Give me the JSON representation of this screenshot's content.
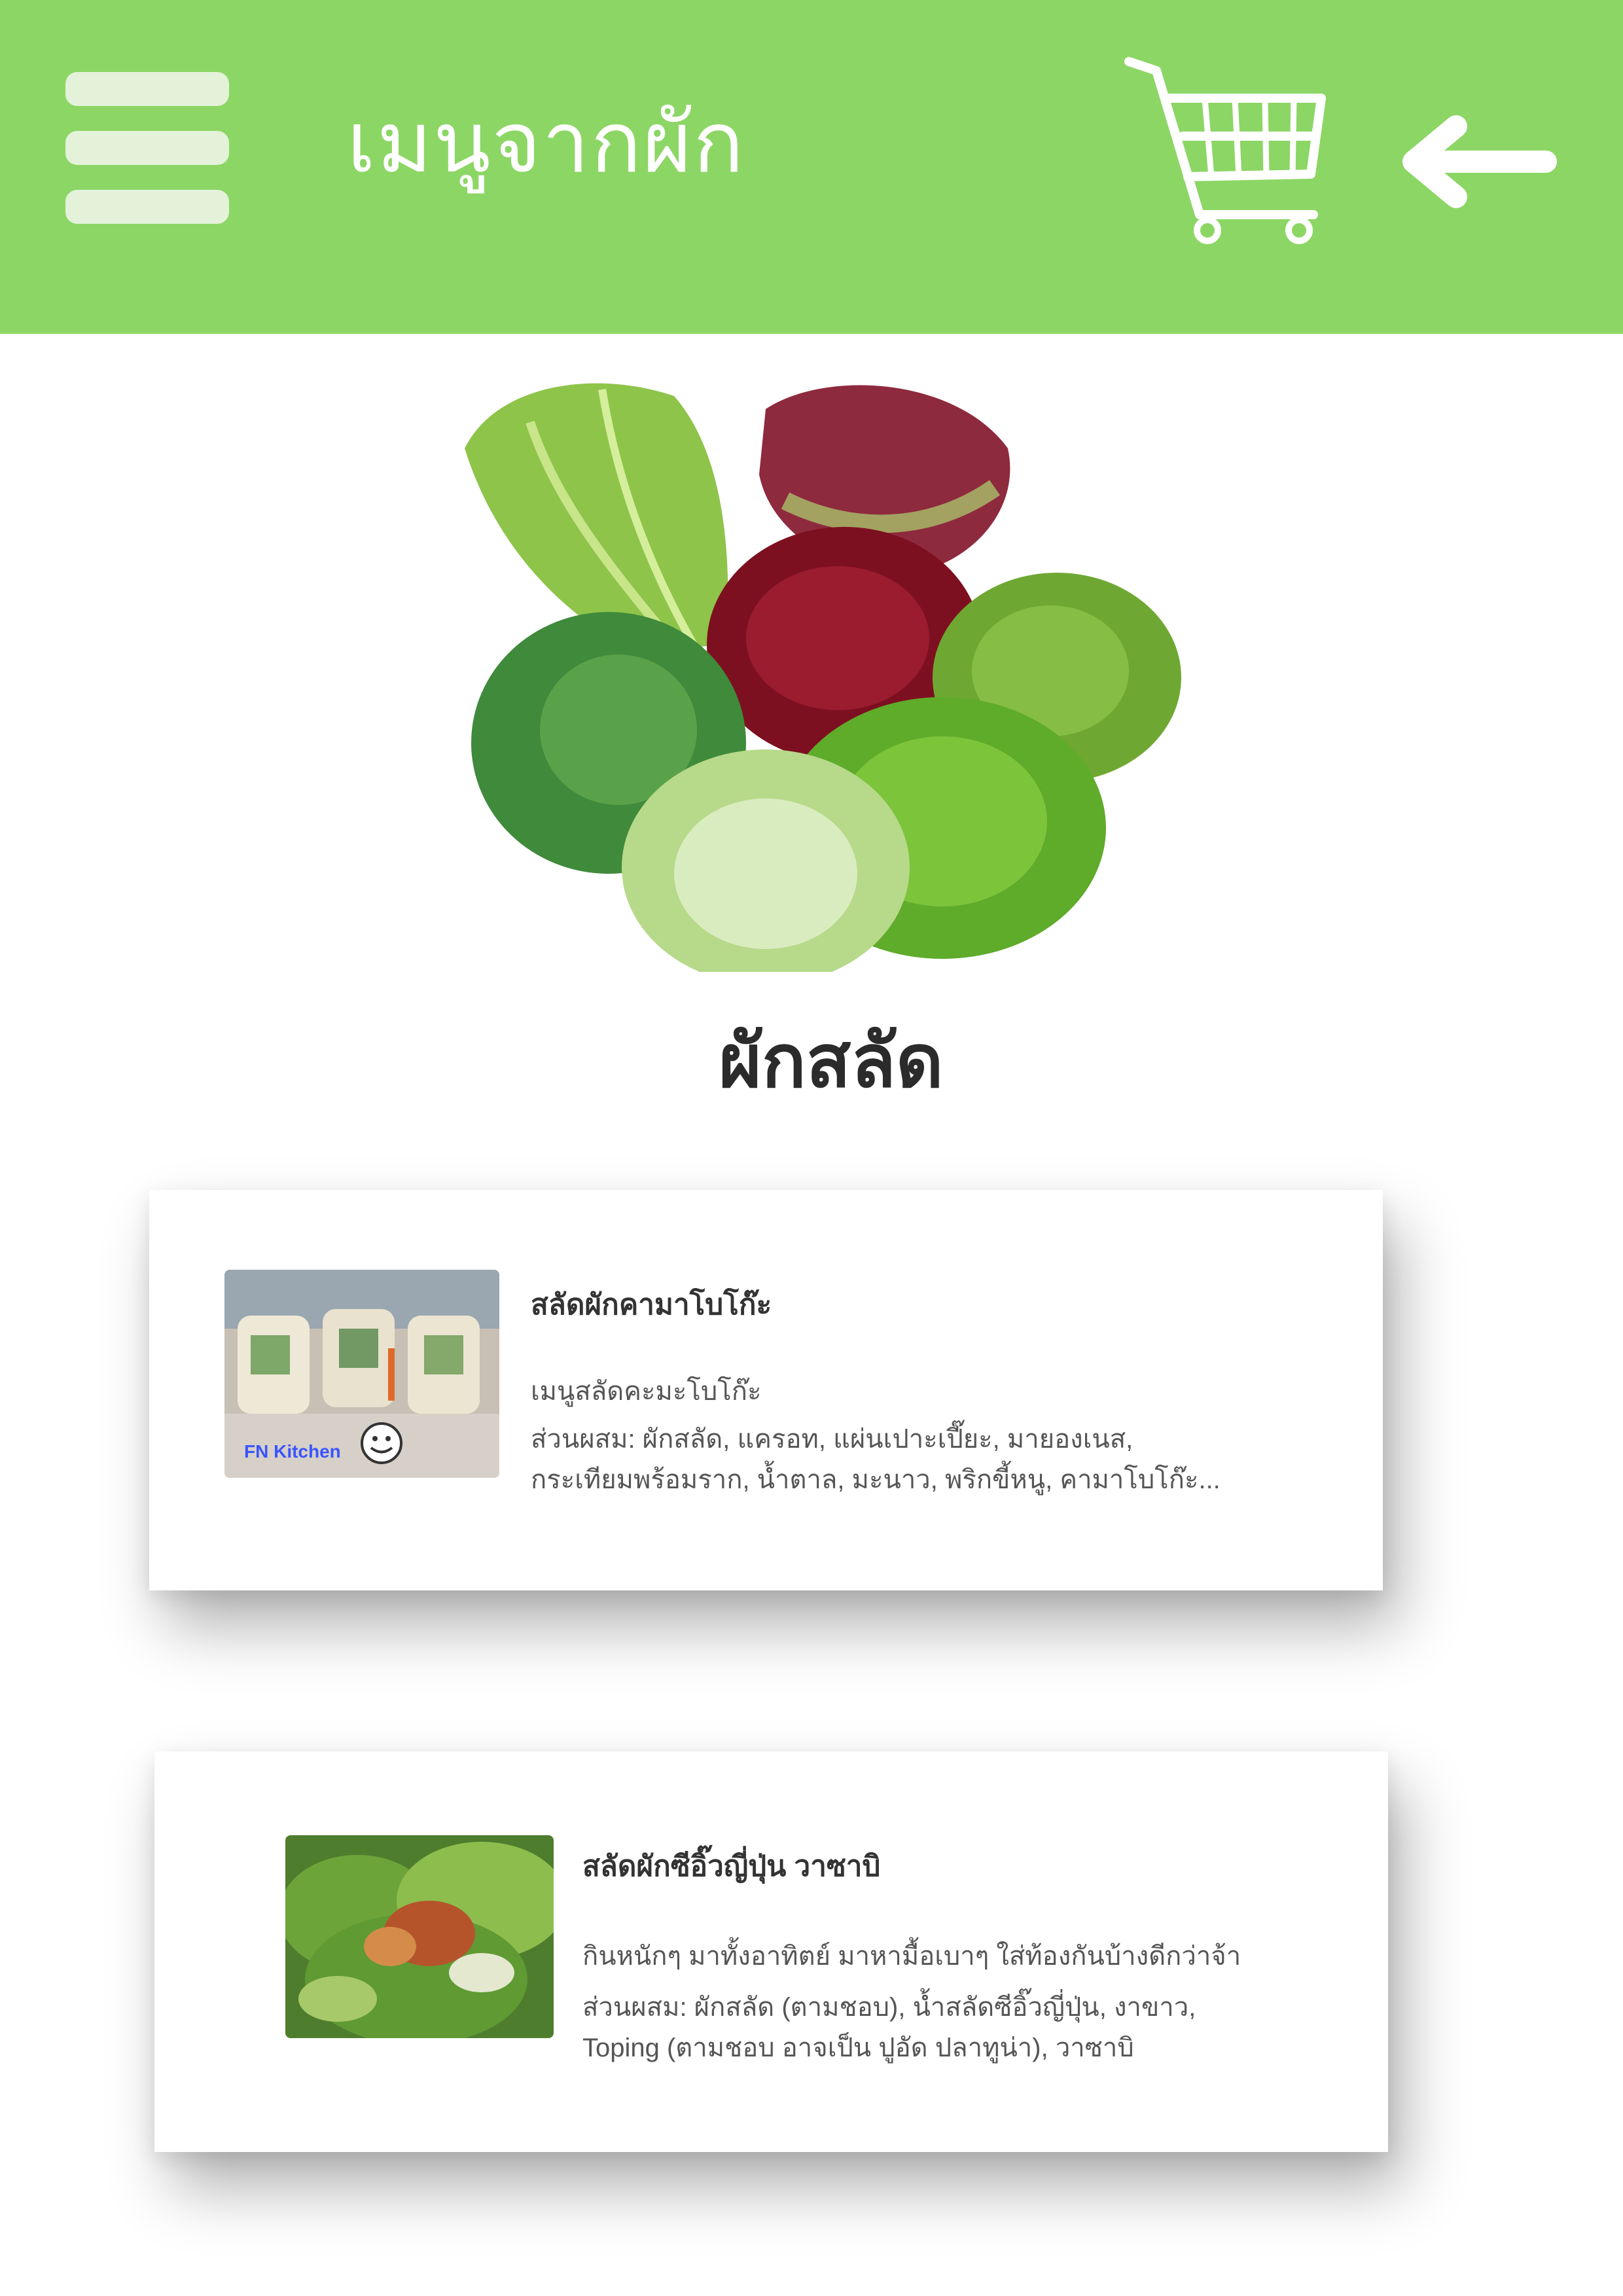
{
  "header": {
    "title": "เมนูจากผัก",
    "menu_icon": "hamburger-menu-icon",
    "cart_icon": "shopping-cart-icon",
    "back_icon": "back-arrow-icon",
    "background_color": "#8cd665"
  },
  "hero": {
    "image": "lettuce-varieties-photo"
  },
  "section": {
    "title": "ผักสลัด"
  },
  "recipes": [
    {
      "title": "สลัดผักคามาโบโก๊ะ",
      "description": "เมนูสลัดคะมะโบโก๊ะ",
      "ingredients_line1": "ส่วนผสม: ผักสลัด, แครอท, แผ่นเปาะเปี๊ยะ, มายองเนส,",
      "ingredients_line2": "กระเทียมพร้อมราก, น้ำตาล, มะนาว, พริกขี้หนู, คามาโบโก๊ะ...",
      "thumbnail": "salad-roll-photo",
      "thumbnail_watermark": "FN Kitchen"
    },
    {
      "title": "สลัดผักซีอิ๊วญี่ปุ่น วาซาบิ",
      "description": "กินหนักๆ มาทั้งอาทิตย์ มาหามื้อเบาๆ ใส่ท้องกันบ้างดีกว่าจ้า",
      "ingredients_line1": "ส่วนผสม: ผักสลัด (ตามชอบ), น้ำสลัดซีอิ๊วญี่ปุ่น, งาขาว,",
      "ingredients_line2": "Toping (ตามชอบ อาจเป็น ปูอัด ปลาทูน่า), วาซาบิ",
      "thumbnail": "green-salad-photo"
    }
  ]
}
